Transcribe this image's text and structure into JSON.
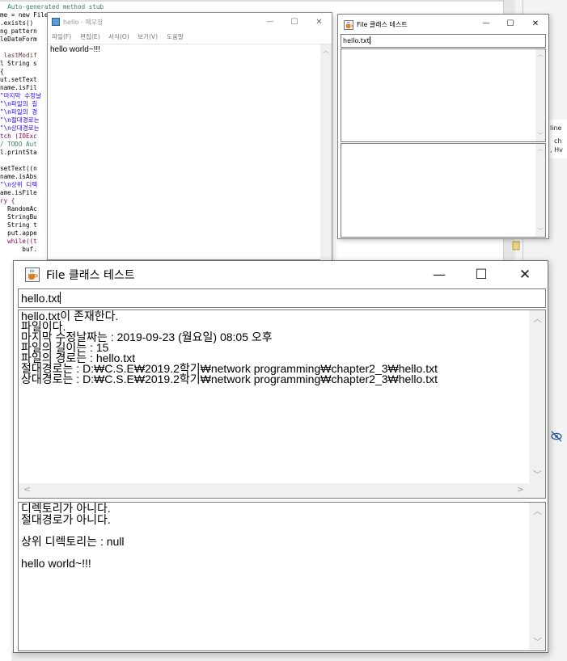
{
  "code_editor": {
    "lines": [
      {
        "text": "  Auto-generated method stub",
        "style": "cm"
      },
      {
        "text": "me = new File(s.getListSource());",
        "style": ""
      },
      {
        "text": ".exists()",
        "style": ""
      },
      {
        "text": "ng pattern",
        "style": ""
      },
      {
        "text": "leDateForm",
        "style": ""
      },
      {
        "text": "",
        "style": ""
      },
      {
        "text": " lastModif",
        "style": "mv"
      },
      {
        "text": "l String s",
        "style": ""
      },
      {
        "text": "{",
        "style": ""
      },
      {
        "text": "ut.setText",
        "style": ""
      },
      {
        "text": "name.isFil",
        "style": ""
      },
      {
        "text": "\"마지막 수정날",
        "style": "st"
      },
      {
        "text": "\"\\n파일의 길",
        "style": "st"
      },
      {
        "text": "\"\\n파일의 경",
        "style": "st"
      },
      {
        "text": "\"\\n절대경로는",
        "style": "st"
      },
      {
        "text": "\"\\n상대경로는",
        "style": "st"
      },
      {
        "text": "tch (IOExc",
        "style": "kw"
      },
      {
        "text": "/ TODO Aut",
        "style": "cm"
      },
      {
        "text": "l.printSta",
        "style": ""
      },
      {
        "text": "",
        "style": ""
      },
      {
        "text": "setText((n",
        "style": ""
      },
      {
        "text": "name.isAbs",
        "style": ""
      },
      {
        "text": "\"\\n상위 디렉",
        "style": "st"
      },
      {
        "text": "ame.isFile",
        "style": ""
      },
      {
        "text": "ry {",
        "style": "kw"
      },
      {
        "text": "  RandomAc",
        "style": ""
      },
      {
        "text": "  StringBu",
        "style": ""
      },
      {
        "text": "  String t",
        "style": ""
      },
      {
        "text": "  put.appe",
        "style": ""
      },
      {
        "text": "  while((t",
        "style": "kw"
      },
      {
        "text": "      buf.",
        "style": ""
      }
    ],
    "side_texts": [
      "line",
      "ch",
      ", Hv"
    ]
  },
  "notepad": {
    "title": "hello - 메모장",
    "menu": [
      "파일(F)",
      "편집(E)",
      "서식(O)",
      "보기(V)",
      "도움말"
    ],
    "content": "hello world~!!!",
    "buttons": {
      "minimize": "—",
      "maximize": "☐",
      "close": "✕"
    }
  },
  "small_window": {
    "title": "File 클래스 테스트",
    "input_value": "hello.txt",
    "buttons": {
      "minimize": "—",
      "maximize": "☐",
      "close": "✕"
    }
  },
  "main_window": {
    "title": "File 클래스 테스트",
    "input_value": "hello.txt",
    "buttons": {
      "minimize": "—",
      "maximize": "☐",
      "close": "✕"
    },
    "info_lines": [
      "hello.txt이 존재한다.",
      "파일이다.",
      "마지막 수정날짜는 : 2019-09-23 (월요일) 08:05 오후",
      "파일의 길이는 : 15",
      "파일의 경로는 : hello.txt",
      "절대경로는 : D:₩C.S.E₩2019.2학기₩network programming₩chapter2_3₩hello.txt",
      "상대경로는 : D:₩C.S.E₩2019.2학기₩network programming₩chapter2_3₩hello.txt"
    ],
    "detail_lines": [
      "디렉토리가 아니다.",
      "절대경로가 아니다.",
      "",
      "상위 디렉토리는 : null",
      "",
      "hello world~!!!"
    ]
  },
  "colors": {
    "java_border": "#7a7a7a",
    "scroll_track": "#f0f0f0",
    "notepad_icon": "#5d9bd5"
  }
}
